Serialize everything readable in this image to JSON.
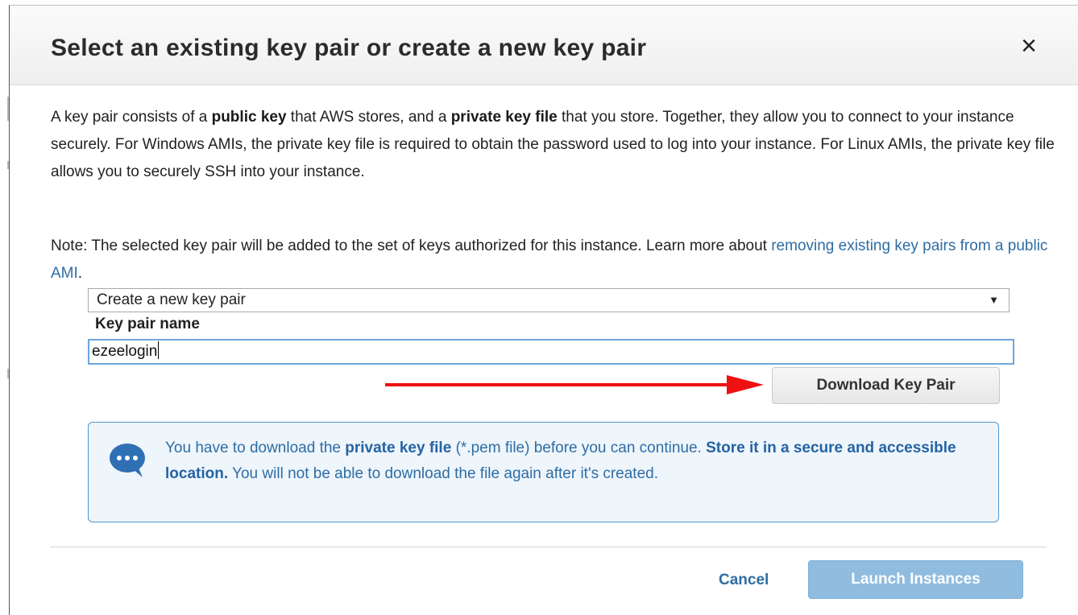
{
  "dialog": {
    "title": "Select an existing key pair or create a new key pair",
    "close_label": "×"
  },
  "description": {
    "p1_a": "A key pair consists of a ",
    "p1_b": "public key",
    "p1_c": " that AWS stores, and a ",
    "p1_d": "private key file",
    "p1_e": " that you store. Together, they allow you to connect to your instance securely. For Windows AMIs, the private key file is required to obtain the password used to log into your instance. For Linux AMIs, the private key file allows you to securely SSH into your instance.",
    "note_a": "Note: The selected key pair will be added to the set of keys authorized for this instance. Learn more about ",
    "note_link": "removing existing key pairs from a public AMI",
    "note_b": "."
  },
  "form": {
    "key_pair_option": "Create a new key pair",
    "select_arrow": "▼",
    "key_pair_name_label": "Key pair name",
    "key_pair_name_value": "ezeelogin",
    "download_label": "Download Key Pair"
  },
  "info": {
    "icon": "chat-bubble-icon",
    "t1": "You have to download the ",
    "t2": "private key file",
    "t3": " (*.pem file) before you can continue. ",
    "t4": "Store it in a secure and accessible location.",
    "t5": " You will not be able to download the file again after it's created."
  },
  "footer": {
    "cancel_label": "Cancel",
    "launch_label": "Launch Instances"
  },
  "colors": {
    "annotation_arrow": "#ee1111",
    "link": "#2e6da4",
    "info_border": "#4f97d1",
    "launch_disabled": "#8fbcdf"
  }
}
